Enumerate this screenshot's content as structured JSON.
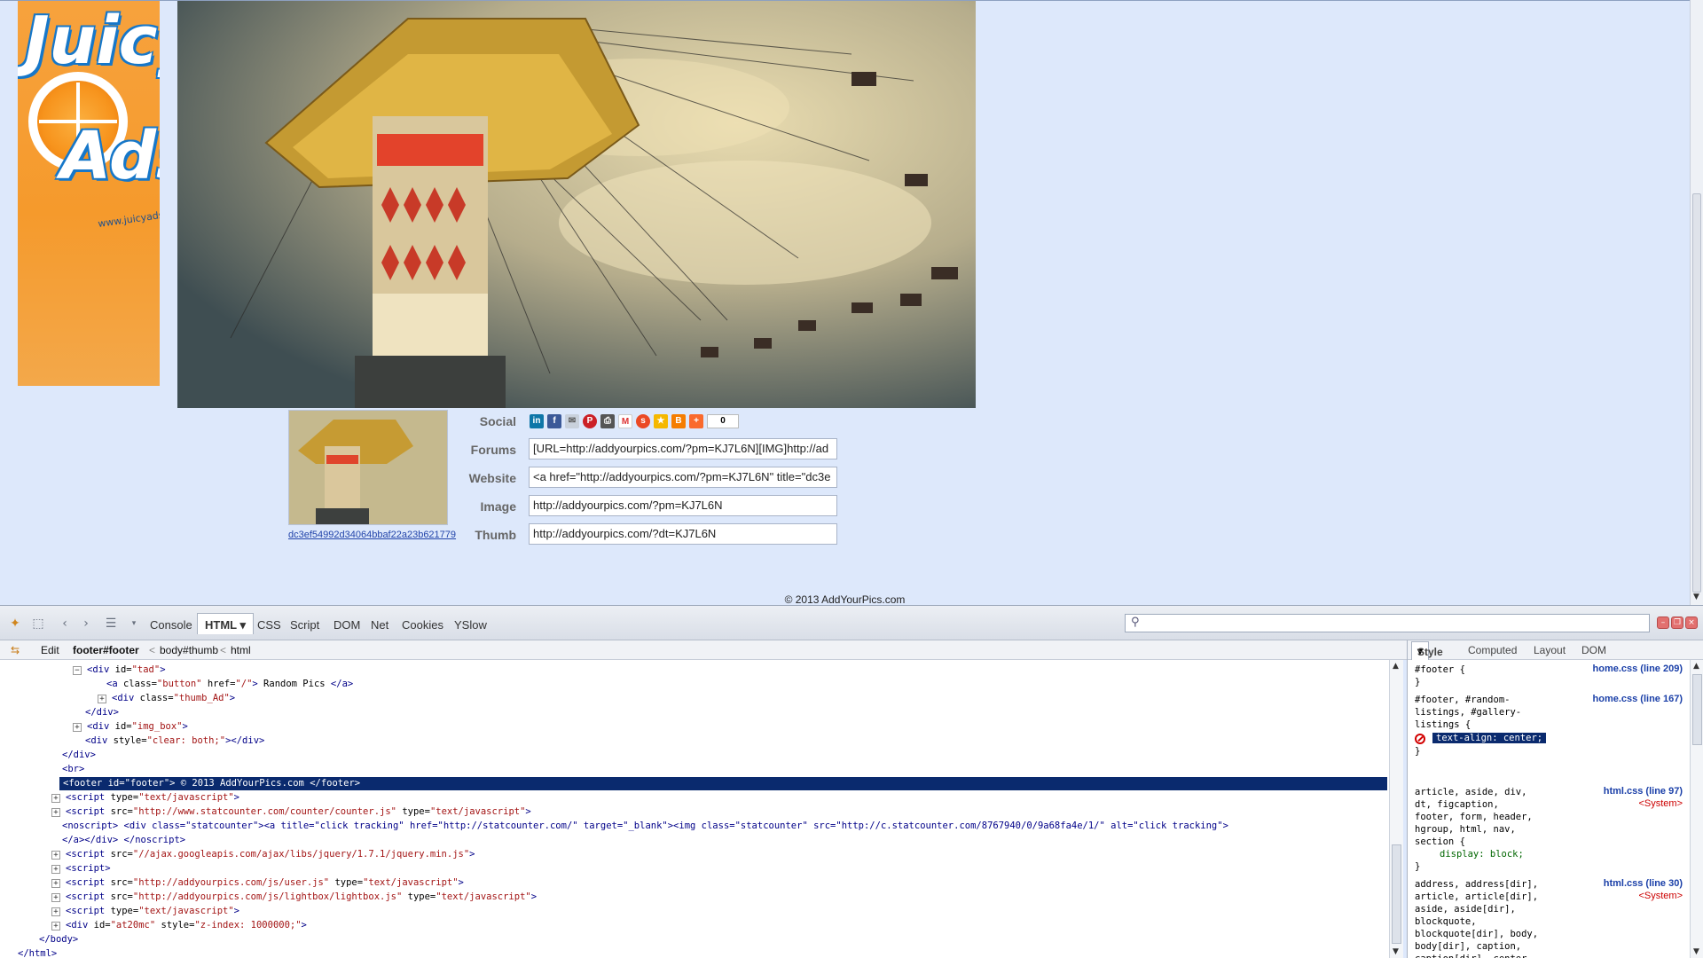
{
  "page": {
    "ad_banner": {
      "word1": "Juicy",
      "word2": "Ads",
      "url": "www.juicyads.com"
    },
    "share": {
      "labels": {
        "social": "Social",
        "forums": "Forums",
        "website": "Website",
        "image": "Image",
        "thumb": "Thumb"
      },
      "forums_value": "[URL=http://addyourpics.com/?pm=KJ7L6N][IMG]http://ad",
      "website_value": "<a href=\"http://addyourpics.com/?pm=KJ7L6N\" title=\"dc3e",
      "image_value": "http://addyourpics.com/?pm=KJ7L6N",
      "thumb_value": "http://addyourpics.com/?dt=KJ7L6N",
      "thumb_link": "dc3ef54992d34064bbaf22a23b621779",
      "share_count": "0",
      "social_icons": [
        "linkedin-icon",
        "facebook-icon",
        "email-icon",
        "pinterest-icon",
        "print-icon",
        "gmail-icon",
        "stumbleupon-icon",
        "favorites-icon",
        "blogger-icon",
        "more-icon"
      ]
    },
    "copyright": "© 2013 AddYourPics.com"
  },
  "firebug": {
    "tabs": [
      "Console",
      "HTML",
      "CSS",
      "Script",
      "DOM",
      "Net",
      "Cookies",
      "YSlow"
    ],
    "active_tab": "HTML",
    "breadcrumbs": {
      "edit": "Edit",
      "items": [
        "footer#footer",
        "body#thumb",
        "html"
      ]
    },
    "html_lines": [
      {
        "tog": "−",
        "t1": "<div",
        "a1": " id=",
        "v1": "\"tad\"",
        "t2": ">",
        "rest": ""
      },
      {
        "tog": "",
        "t1": "<a",
        "a1": " class=",
        "v1": "\"button\"",
        "a2": " href=",
        "v2": "\"/\"",
        "t2": ">",
        "rest": " Random Pics ",
        "t3": "</a>"
      },
      {
        "tog": "+",
        "t1": "<div",
        "a1": " class=",
        "v1": "\"thumb_Ad\"",
        "t2": ">",
        "rest": ""
      },
      {
        "tog": "",
        "t1": "</div>",
        "rest": ""
      },
      {
        "tog": "+",
        "t1": "<div",
        "a1": " id=",
        "v1": "\"img_box\"",
        "t2": ">",
        "rest": ""
      },
      {
        "tog": "",
        "t1": "<div",
        "a1": " style=",
        "v1": "\"clear: both;\"",
        "t2": ">",
        "rest": "",
        "t3": "</div>"
      },
      {
        "tog": "",
        "t1": "</div>",
        "rest": ""
      },
      {
        "tog": "",
        "t1": "<br>",
        "rest": ""
      },
      {
        "tog": "",
        "t1": "<footer",
        "a1": " id=",
        "v1": "\"footer\"",
        "t2": ">",
        "rest": " © 2013 AddYourPics.com ",
        "t3": "</footer>"
      },
      {
        "tog": "+",
        "t1": "<script",
        "a1": " type=",
        "v1": "\"text/javascript\"",
        "t2": ">",
        "rest": ""
      },
      {
        "tog": "+",
        "t1": "<script",
        "a1": " src=",
        "v1": "\"http://www.statcounter.com/counter/counter.js\"",
        "a2": " type=",
        "v2": "\"text/javascript\"",
        "t2": ">",
        "rest": ""
      },
      {
        "tog": "",
        "t1": "<noscript>",
        "rest": " ",
        "t3": "<div class=\"statcounter\"><a title=\"click tracking\" href=\"http://statcounter.com/\" target=\"_blank\"><img class=\"statcounter\" src=\"http://c.statcounter.com/8767940/0/9a68fa4e/1/\" alt=\"click tracking\">"
      },
      {
        "tog": "",
        "t1": "</a></div>",
        "rest": " ",
        "t3": "</noscript>"
      },
      {
        "tog": "+",
        "t1": "<script",
        "a1": " src=",
        "v1": "\"//ajax.googleapis.com/ajax/libs/jquery/1.7.1/jquery.min.js\"",
        "t2": ">",
        "rest": ""
      },
      {
        "tog": "+",
        "t1": "<script>",
        "rest": ""
      },
      {
        "tog": "+",
        "t1": "<script",
        "a1": " src=",
        "v1": "\"http://addyourpics.com/js/user.js\"",
        "a2": " type=",
        "v2": "\"text/javascript\"",
        "t2": ">",
        "rest": ""
      },
      {
        "tog": "+",
        "t1": "<script",
        "a1": " src=",
        "v1": "\"http://addyourpics.com/js/lightbox/lightbox.js\"",
        "a2": " type=",
        "v2": "\"text/javascript\"",
        "t2": ">",
        "rest": ""
      },
      {
        "tog": "+",
        "t1": "<script",
        "a1": " type=",
        "v1": "\"text/javascript\"",
        "t2": ">",
        "rest": ""
      },
      {
        "tog": "+",
        "t1": "<div",
        "a1": " id=",
        "v1": "\"at20mc\"",
        "a2": " style=",
        "v2": "\"z-index: 1000000;\"",
        "t2": ">",
        "rest": ""
      },
      {
        "tog": "",
        "t1": "</body>",
        "rest": ""
      },
      {
        "tog": "",
        "t1": "</html>",
        "rest": ""
      }
    ],
    "side_tabs": [
      "Style",
      "Computed",
      "Layout",
      "DOM"
    ],
    "style_rules": {
      "r1_selector": "#footer {\n}",
      "r1_src": "home.css (line 209)",
      "r2_selector": "#footer, #random-\nlistings, #gallery-\nlistings {",
      "r2_src": "home.css (line 167)",
      "r2_prop": "text-align: center;",
      "r3_selector": "article, aside, div,\ndt, figcaption,\nfooter, form, header,\nhgroup, html, nav,\nsection {",
      "r3_prop": "display: block;",
      "r3_src": "html.css (line 97)",
      "r3_sys": "<System>",
      "r4_selector": "address, address[dir],\narticle, article[dir],\naside, aside[dir],\nblockquote,\nblockquote[dir], body,\nbody[dir], caption,\ncaption[dir], center,\ncenter[dir], col,",
      "r4_src": "html.css (line 30)",
      "r4_sys": "<System>",
      "close": "}"
    }
  }
}
